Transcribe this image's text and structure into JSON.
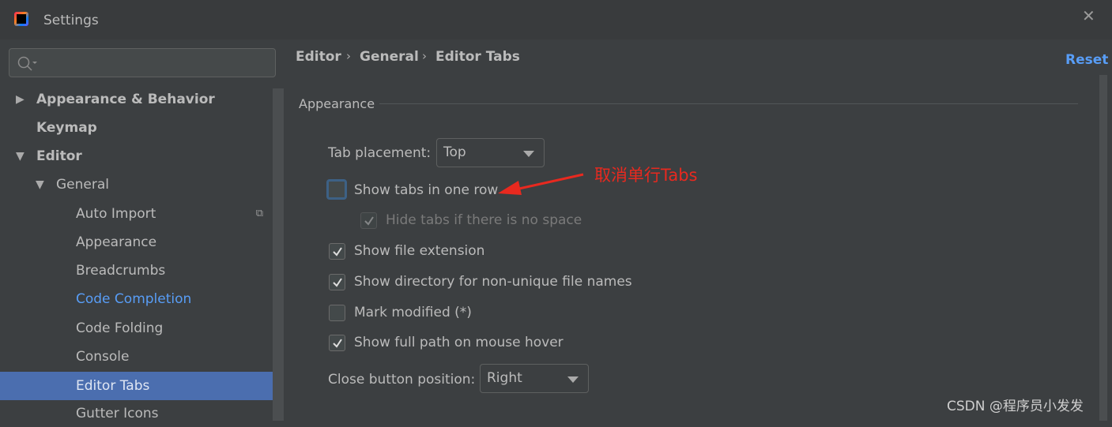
{
  "window": {
    "title": "Settings",
    "close_icon": "close-icon"
  },
  "search": {
    "placeholder": "",
    "value": ""
  },
  "sidebar": {
    "items": [
      {
        "label": "Appearance & Behavior",
        "bold": true,
        "expand": "collapsed"
      },
      {
        "label": "Keymap",
        "bold": true
      },
      {
        "label": "Editor",
        "bold": true,
        "expand": "expanded"
      },
      {
        "label": "General",
        "expand": "expanded"
      },
      {
        "label": "Auto Import"
      },
      {
        "label": "Appearance"
      },
      {
        "label": "Breadcrumbs"
      },
      {
        "label": "Code Completion",
        "color": "#589df6"
      },
      {
        "label": "Code Folding"
      },
      {
        "label": "Console"
      },
      {
        "label": "Editor Tabs",
        "selected": true
      },
      {
        "label": "Gutter Icons"
      }
    ]
  },
  "breadcrumb": [
    "Editor",
    "General",
    "Editor Tabs"
  ],
  "reset_label": "Reset",
  "section": {
    "title": "Appearance"
  },
  "tab_placement": {
    "label": "Tab placement:",
    "value": "Top"
  },
  "options": [
    {
      "label": "Show tabs in one row",
      "checked": false,
      "focused": true
    },
    {
      "label": "Hide tabs if there is no space",
      "checked": true,
      "disabled": true
    },
    {
      "label": "Show file extension",
      "checked": true
    },
    {
      "label": "Show directory for non-unique file names",
      "checked": true
    },
    {
      "label": "Mark modified (*)",
      "checked": false
    },
    {
      "label": "Show full path on mouse hover",
      "checked": true
    }
  ],
  "close_button": {
    "label": "Close button position:",
    "value": "Right"
  },
  "annotation": {
    "text": "取消单行Tabs",
    "color": "#e8291f"
  },
  "watermark": "CSDN @程序员小发发",
  "colors": {
    "accent": "#4b6eaf",
    "link": "#589df6"
  }
}
